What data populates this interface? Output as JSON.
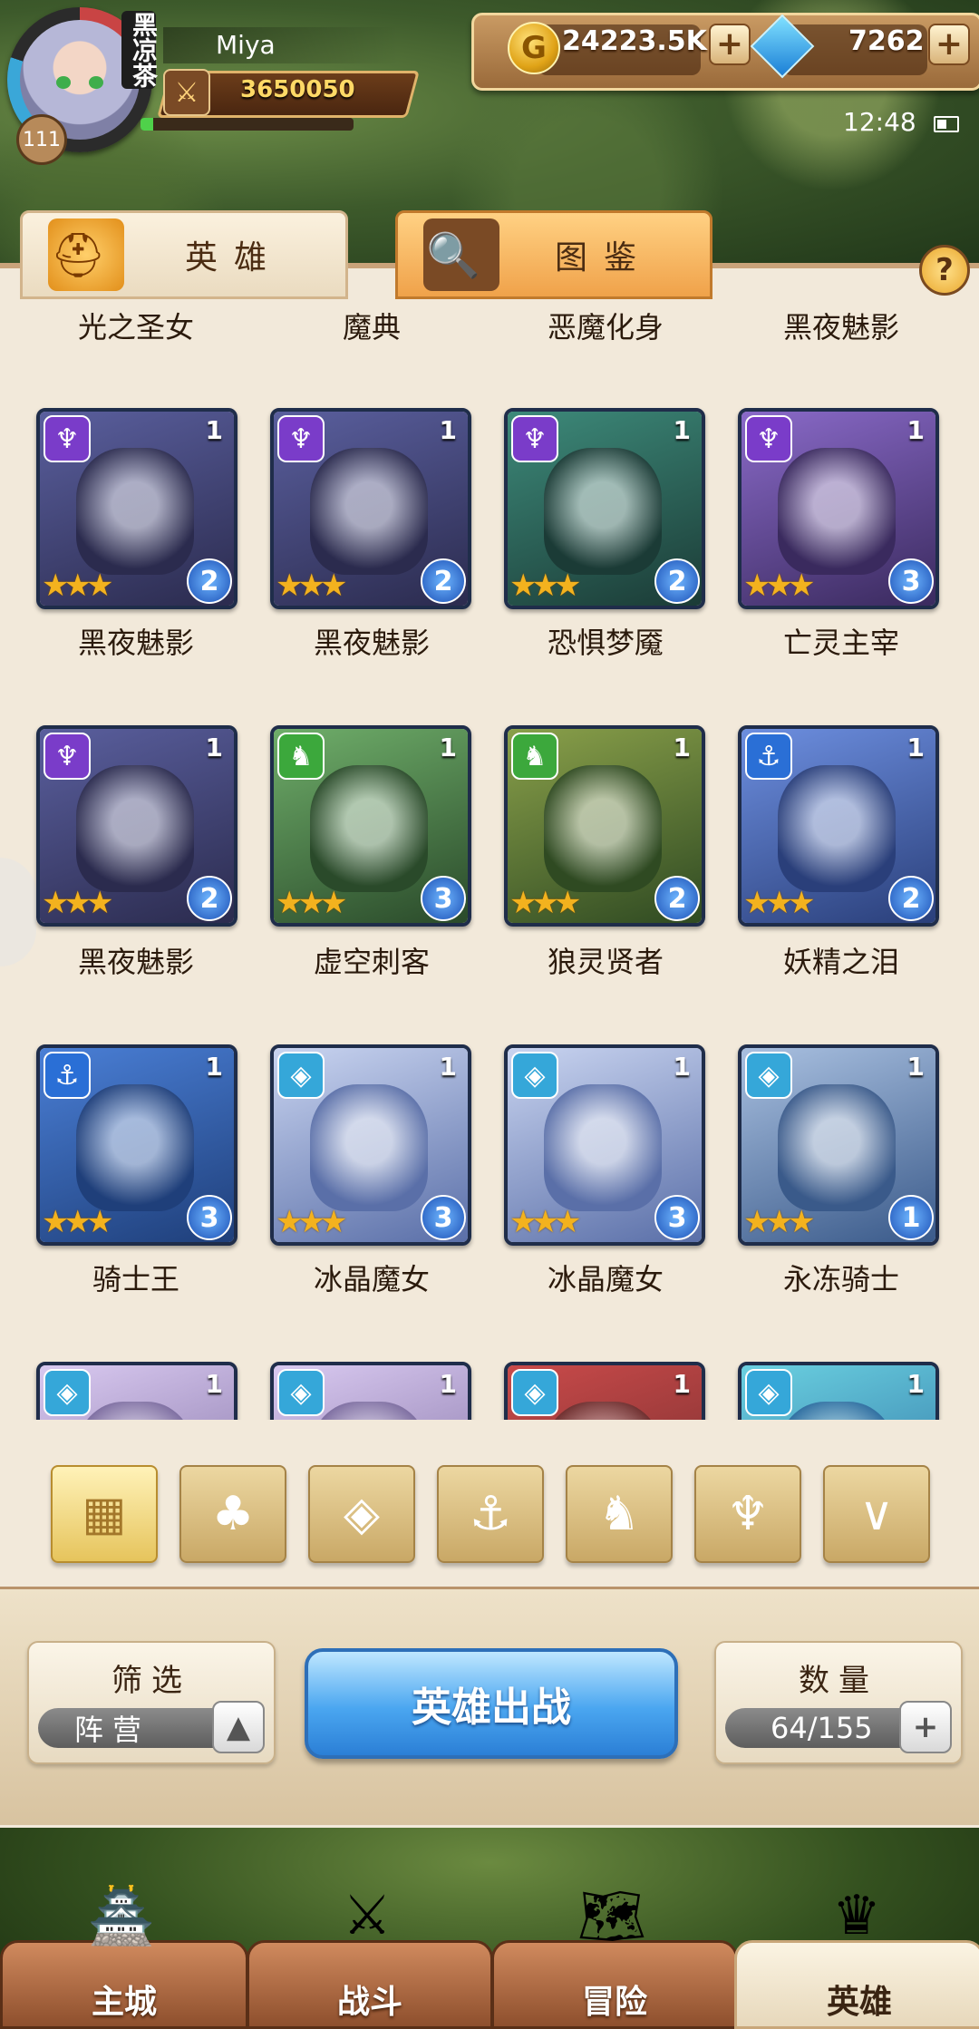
{
  "player": {
    "name": "Miya",
    "level": "111",
    "vip_label": "黑凉茶",
    "power": "3650050",
    "exp_fraction": 0.06
  },
  "resources": {
    "gold": "24223.5K",
    "gems": "7262",
    "gold_icon_glyph": "G",
    "plus": "+"
  },
  "status": {
    "time": "12:48"
  },
  "tabs": {
    "heroes": "英雄",
    "codex": "图鉴",
    "help": "?"
  },
  "top_names": [
    "光之圣女",
    "魔典",
    "恶魔化身",
    "黑夜魅影"
  ],
  "cards": [
    {
      "name": "黑夜魅影",
      "count": "1",
      "stars": "★★★",
      "badge": "2",
      "faction": "demon",
      "colors": [
        "#2b2b4e",
        "#5a5f9e"
      ]
    },
    {
      "name": "黑夜魅影",
      "count": "1",
      "stars": "★★★",
      "badge": "2",
      "faction": "demon",
      "colors": [
        "#2b2b4e",
        "#5a5f9e"
      ]
    },
    {
      "name": "恐惧梦魇",
      "count": "1",
      "stars": "★★★",
      "badge": "2",
      "faction": "demon",
      "colors": [
        "#1b3b36",
        "#3d8a7a"
      ]
    },
    {
      "name": "亡灵主宰",
      "count": "1",
      "stars": "★★★",
      "badge": "3",
      "faction": "demon",
      "colors": [
        "#3a2a5e",
        "#8a6ac9"
      ]
    },
    {
      "name": "黑夜魅影",
      "count": "1",
      "stars": "★★★",
      "badge": "2",
      "faction": "demon",
      "colors": [
        "#2b2b4e",
        "#5a5f9e"
      ]
    },
    {
      "name": "虚空刺客",
      "count": "1",
      "stars": "★★★",
      "badge": "3",
      "faction": "beast",
      "colors": [
        "#2a4a2a",
        "#6fae6a"
      ]
    },
    {
      "name": "狼灵贤者",
      "count": "1",
      "stars": "★★★",
      "badge": "2",
      "faction": "beast",
      "colors": [
        "#2f4a22",
        "#8aa04a"
      ]
    },
    {
      "name": "妖精之泪",
      "count": "1",
      "stars": "★★★",
      "badge": "2",
      "faction": "ocean",
      "colors": [
        "#2a3f7a",
        "#6d8fe0"
      ]
    },
    {
      "name": "骑士王",
      "count": "1",
      "stars": "★★★",
      "badge": "3",
      "faction": "ocean",
      "colors": [
        "#1f3f7a",
        "#4a7fd6"
      ]
    },
    {
      "name": "冰晶魔女",
      "count": "1",
      "stars": "★★★",
      "badge": "3",
      "faction": "ice",
      "colors": [
        "#5a6fa8",
        "#c9d4f0"
      ]
    },
    {
      "name": "冰晶魔女",
      "count": "1",
      "stars": "★★★",
      "badge": "3",
      "faction": "ice",
      "colors": [
        "#5a6fa8",
        "#c9d4f0"
      ]
    },
    {
      "name": "永冻骑士",
      "count": "1",
      "stars": "★★★",
      "badge": "1",
      "faction": "ice",
      "colors": [
        "#3a5a8a",
        "#a9c0e0"
      ]
    },
    {
      "name": "",
      "count": "1",
      "stars": "",
      "badge": "",
      "faction": "ice",
      "colors": [
        "#7a6a9e",
        "#d9c9f0"
      ]
    },
    {
      "name": "",
      "count": "1",
      "stars": "",
      "badge": "",
      "faction": "ice",
      "colors": [
        "#7a6a9e",
        "#d9c9f0"
      ]
    },
    {
      "name": "",
      "count": "1",
      "stars": "",
      "badge": "",
      "faction": "ice",
      "colors": [
        "#6a2a2a",
        "#c94a4a"
      ]
    },
    {
      "name": "",
      "count": "1",
      "stars": "",
      "badge": "",
      "faction": "ice",
      "colors": [
        "#2a6a9e",
        "#6ad0e0"
      ]
    }
  ],
  "faction_glyphs": {
    "demon": "♆",
    "beast": "♞",
    "ocean": "⚓",
    "ice": "◈"
  },
  "faction_colors": {
    "demon": "#7a3cc9",
    "beast": "#3ca83c",
    "ocean": "#2a6fd6",
    "ice": "#35a7d9"
  },
  "filters": [
    {
      "id": "all",
      "glyph": "▦"
    },
    {
      "id": "forest",
      "glyph": "♣"
    },
    {
      "id": "ice",
      "glyph": "◈"
    },
    {
      "id": "ocean",
      "glyph": "⚓"
    },
    {
      "id": "beast",
      "glyph": "♞"
    },
    {
      "id": "demon",
      "glyph": "♆"
    },
    {
      "id": "shadow",
      "glyph": "∨"
    }
  ],
  "bottom": {
    "filter_title": "筛选",
    "filter_value": "阵营",
    "filter_toggle": "▲",
    "deploy": "英雄出战",
    "quantity_title": "数量",
    "quantity_value": "64/155",
    "quantity_plus": "+"
  },
  "nav": [
    {
      "label": "主城",
      "icon": "🏯"
    },
    {
      "label": "战斗",
      "icon": "⚔"
    },
    {
      "label": "冒险",
      "icon": "🗺"
    },
    {
      "label": "英雄",
      "icon": "♛"
    }
  ],
  "colors": {
    "panel": "#f2e9da",
    "accent_gold": "#e6c45c",
    "deploy_blue": "#4aa6f0"
  }
}
